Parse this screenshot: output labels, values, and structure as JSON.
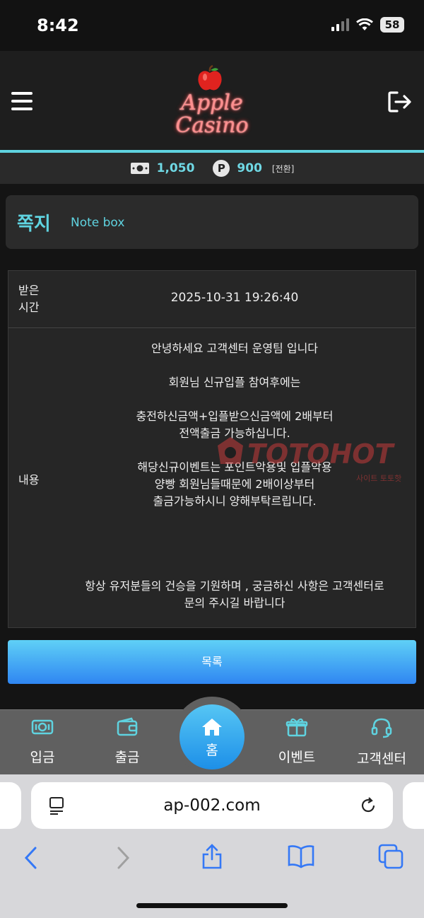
{
  "status_bar": {
    "time": "8:42",
    "battery": "58"
  },
  "header": {
    "logo_line1": "Apple",
    "logo_line2": "Casino",
    "menu_icon": "hamburger-icon",
    "logout_icon": "logout-icon"
  },
  "balance": {
    "money": "1,050",
    "point_symbol": "P",
    "point": "900",
    "convert_label": "[전환]"
  },
  "page": {
    "title": "쪽지",
    "subtitle": "Note box"
  },
  "message": {
    "time_label_line1": "받은",
    "time_label_line2": "시간",
    "time_value": "2025-10-31 19:26:40",
    "content_label": "내용",
    "lines": {
      "l1": "안녕하세요 고객센터 운영팀 입니다",
      "l2": "회원님 신규입플 참여후에는",
      "l3": "충전하신금액+입플받으신금액에 2배부터",
      "l4": "전액출금 가능하십니다.",
      "l5": "해당신규이벤트는 포인트악용및 입플악용",
      "l6": "양빵 회원님들때문에 2배이상부터",
      "l7": "출금가능하시니 양해부탁르립니다.",
      "l8": "항상 유저분들의 건승을 기원하며 , 궁금하신 사항은 고객센터로",
      "l9": "문의 주시길 바랍니다"
    }
  },
  "watermark": {
    "logo": "TOTOHOT",
    "sub": "사이트 토토핫"
  },
  "list_button": "목록",
  "bottom_nav": {
    "deposit": "입금",
    "withdraw": "출금",
    "home": "홈",
    "event": "이벤트",
    "support": "고객센터"
  },
  "browser": {
    "url": "ap-002.com"
  },
  "colors": {
    "accent": "#5fd3e0",
    "button": "#2f86f2",
    "logo": "#ff6b6b"
  }
}
